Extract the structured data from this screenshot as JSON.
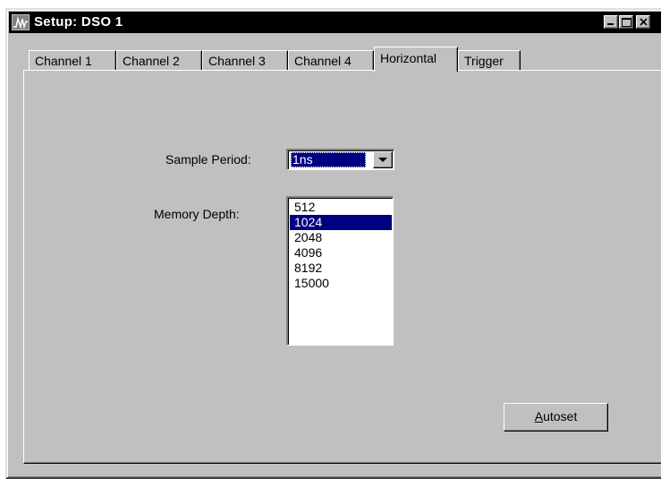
{
  "window": {
    "title": "Setup: DSO 1"
  },
  "tabs": [
    {
      "label": "Channel 1",
      "active": false
    },
    {
      "label": "Channel 2",
      "active": false
    },
    {
      "label": "Channel 3",
      "active": false
    },
    {
      "label": "Channel 4",
      "active": false
    },
    {
      "label": "Horizontal",
      "active": true
    },
    {
      "label": "Trigger",
      "active": false
    }
  ],
  "horizontal": {
    "sample_period_label": "Sample Period:",
    "sample_period_value": "1ns",
    "memory_depth_label": "Memory Depth:",
    "memory_depth_options": [
      "512",
      "1024",
      "2048",
      "4096",
      "8192",
      "15000"
    ],
    "memory_depth_selected": "1024",
    "autoset_mnemonic": "A",
    "autoset_rest": "utoset"
  },
  "colors": {
    "face": "#c0c0c0",
    "titlebar": "#000000",
    "selection": "#000080"
  },
  "icons": {
    "app": "waveform-icon",
    "minimize": "minimize-icon",
    "maximize": "maximize-icon",
    "close": "close-icon",
    "dropdown": "chevron-down-icon"
  }
}
